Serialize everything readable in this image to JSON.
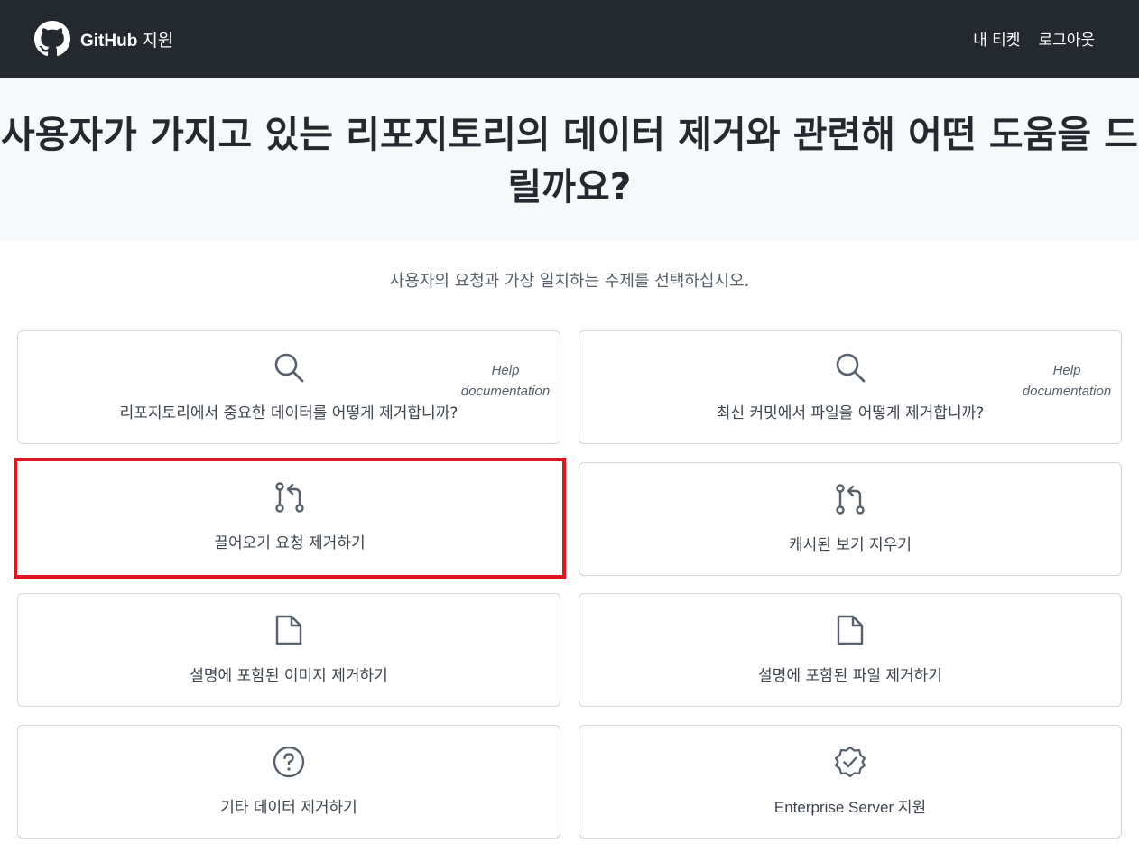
{
  "header": {
    "brand_name": "GitHub",
    "brand_suffix": "지원",
    "nav": [
      "내 티켓",
      "로그아웃"
    ]
  },
  "hero": {
    "title": "사용자가 가지고 있는 리포지토리의 데이터 제거와 관련해 어떤 도움을 드릴까요?"
  },
  "subtitle": "사용자의 요청과 가장 일치하는 주제를 선택하십시오.",
  "cards": [
    {
      "label": "리포지토리에서 중요한 데이터를 어떻게 제거합니까?",
      "icon": "search-icon",
      "tag": "Help documentation"
    },
    {
      "label": "최신 커밋에서 파일을 어떻게 제거합니까?",
      "icon": "search-icon",
      "tag": "Help documentation"
    },
    {
      "label": "끌어오기 요청 제거하기",
      "icon": "pull-request-icon"
    },
    {
      "label": "캐시된 보기 지우기",
      "icon": "pull-request-icon"
    },
    {
      "label": "설명에 포함된 이미지 제거하기",
      "icon": "file-icon"
    },
    {
      "label": "설명에 포함된 파일 제거하기",
      "icon": "file-icon"
    },
    {
      "label": "기타 데이터 제거하기",
      "icon": "question-icon"
    },
    {
      "label": "Enterprise Server 지원",
      "icon": "verified-badge-icon"
    }
  ],
  "colors": {
    "header_bg": "#24292f",
    "hero_bg": "#f6f8fa",
    "highlight": "#e0161f",
    "icon": "#57606a"
  }
}
